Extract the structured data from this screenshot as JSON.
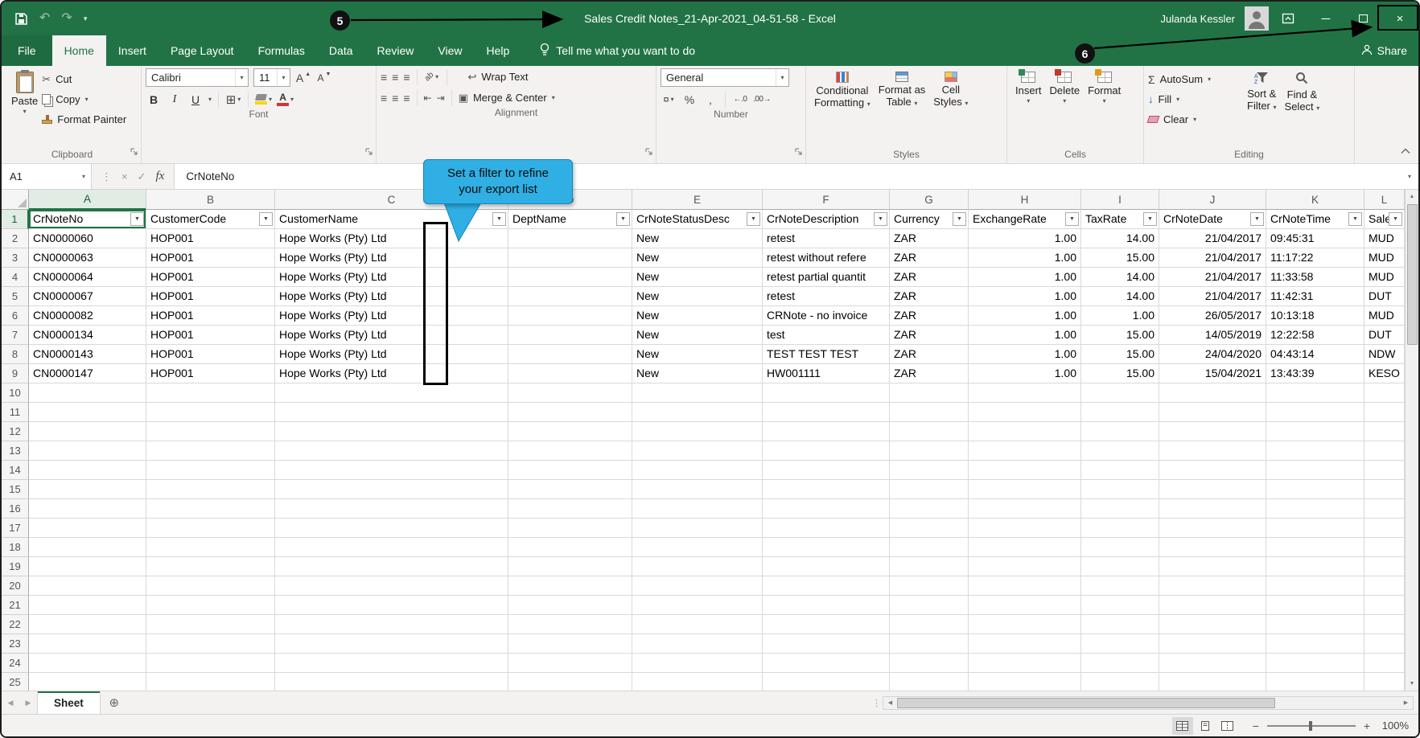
{
  "window": {
    "title": "Sales Credit Notes_21-Apr-2021_04-51-58  -  Excel",
    "user_name": "Julanda Kessler"
  },
  "annotations": {
    "badge_5": "5",
    "badge_6": "6",
    "callout_line1": "Set a filter to refine",
    "callout_line2": "your export list",
    "callout_color": "#2FAFE3"
  },
  "tabs": {
    "file": "File",
    "home": "Home",
    "insert": "Insert",
    "page_layout": "Page Layout",
    "formulas": "Formulas",
    "data": "Data",
    "review": "Review",
    "view": "View",
    "help": "Help",
    "tell_me": "Tell me what you want to do",
    "share": "Share"
  },
  "ribbon": {
    "clipboard": {
      "label": "Clipboard",
      "paste": "Paste",
      "cut": "Cut",
      "copy": "Copy",
      "format_painter": "Format Painter"
    },
    "font": {
      "label": "Font",
      "family": "Calibri",
      "size": "11"
    },
    "alignment": {
      "label": "Alignment",
      "wrap_text": "Wrap Text",
      "merge_center": "Merge & Center"
    },
    "number": {
      "label": "Number",
      "format": "General"
    },
    "styles": {
      "label": "Styles",
      "conditional1": "Conditional",
      "conditional2": "Formatting",
      "table1": "Format as",
      "table2": "Table",
      "cellstyles1": "Cell",
      "cellstyles2": "Styles"
    },
    "cells": {
      "label": "Cells",
      "insert": "Insert",
      "delete": "Delete",
      "format": "Format"
    },
    "editing": {
      "label": "Editing",
      "autosum": "AutoSum",
      "fill": "Fill",
      "clear": "Clear",
      "sort1": "Sort &",
      "sort2": "Filter",
      "find1": "Find &",
      "find2": "Select"
    }
  },
  "formula_bar": {
    "name_box": "A1",
    "fx": "fx",
    "formula": "CrNoteNo"
  },
  "grid": {
    "col_letters": [
      "A",
      "B",
      "C",
      "D",
      "E",
      "F",
      "G",
      "H",
      "I",
      "J",
      "K",
      "L"
    ],
    "header_row": [
      "CrNoteNo",
      "CustomerCode",
      "CustomerName",
      "DeptName",
      "CrNoteStatusDesc",
      "CrNoteDescription",
      "Currency",
      "ExchangeRate",
      "TaxRate",
      "CrNoteDate",
      "CrNoteTime",
      "Sales"
    ],
    "data_rows": [
      [
        "CN0000060",
        "HOP001",
        "Hope Works (Pty) Ltd",
        "",
        "New",
        "retest",
        "ZAR",
        "1.00",
        "14.00",
        "21/04/2017",
        "09:45:31",
        "MUD"
      ],
      [
        "CN0000063",
        "HOP001",
        "Hope Works (Pty) Ltd",
        "",
        "New",
        "retest without refere",
        "ZAR",
        "1.00",
        "15.00",
        "21/04/2017",
        "11:17:22",
        "MUD"
      ],
      [
        "CN0000064",
        "HOP001",
        "Hope Works (Pty) Ltd",
        "",
        "New",
        "retest partial quantit",
        "ZAR",
        "1.00",
        "14.00",
        "21/04/2017",
        "11:33:58",
        "MUD"
      ],
      [
        "CN0000067",
        "HOP001",
        "Hope Works (Pty) Ltd",
        "",
        "New",
        "retest",
        "ZAR",
        "1.00",
        "14.00",
        "21/04/2017",
        "11:42:31",
        "DUT"
      ],
      [
        "CN0000082",
        "HOP001",
        "Hope Works (Pty) Ltd",
        "",
        "New",
        "CRNote - no invoice",
        "ZAR",
        "1.00",
        "1.00",
        "26/05/2017",
        "10:13:18",
        "MUD"
      ],
      [
        "CN0000134",
        "HOP001",
        "Hope Works (Pty) Ltd",
        "",
        "New",
        "test",
        "ZAR",
        "1.00",
        "15.00",
        "14/05/2019",
        "12:22:58",
        "DUT"
      ],
      [
        "CN0000143",
        "HOP001",
        "Hope Works (Pty) Ltd",
        "",
        "New",
        "TEST TEST TEST",
        "ZAR",
        "1.00",
        "15.00",
        "24/04/2020",
        "04:43:14",
        "NDW"
      ],
      [
        "CN0000147",
        "HOP001",
        "Hope Works (Pty) Ltd",
        "",
        "New",
        "HW001111",
        "ZAR",
        "1.00",
        "15.00",
        "15/04/2021",
        "13:43:39",
        "KESO"
      ]
    ],
    "first_data_row_number": 2,
    "total_rows_visible": 25,
    "selected_cell": "A1",
    "col_align": [
      "left",
      "left",
      "left",
      "left",
      "left",
      "left",
      "left",
      "right",
      "right",
      "right",
      "left",
      "left"
    ]
  },
  "sheet_bar": {
    "active_tab": "Sheet"
  },
  "status_bar": {
    "zoom_level": "100%"
  },
  "colors": {
    "excel_green": "#217346",
    "grid_line": "#d9d9d9",
    "selection": "#217346"
  },
  "glyphs": {
    "undo": "↶",
    "redo": "↷",
    "qat_arrow": "▾",
    "minimize": "─",
    "close": "×",
    "dropdown": "▾",
    "filter_arrow": "▼",
    "cut": "✂",
    "sigma": "Σ",
    "fill_arrow": "↓",
    "percent": "%",
    "comma": ",",
    "currency": "¤",
    "inc_decimal": "←.0",
    "dec_decimal": ".00→",
    "bold": "B",
    "italic": "I",
    "underline": "U",
    "borders": "⊞",
    "align_lines": "≡",
    "wrap": "↩",
    "merge": "▣",
    "orient": "ab",
    "grow_font": "A",
    "shrink_font": "A",
    "cancel": "×",
    "check": "✓",
    "vdots": "⋮",
    "left": "◀",
    "right": "▶",
    "up": "▲",
    "down": "▼",
    "plus_circle": "⊕",
    "indent_l": "⇤",
    "indent_r": "⇥",
    "minus": "−",
    "plus": "+"
  }
}
